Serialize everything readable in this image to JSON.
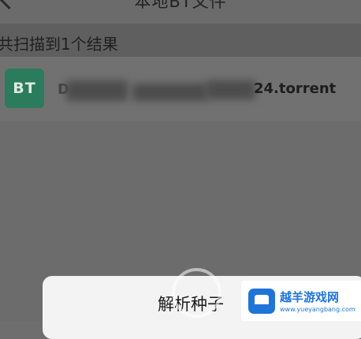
{
  "header": {
    "title": "本地BT文件"
  },
  "results": {
    "count_text": "共扫描到1个结果",
    "items": [
      {
        "icon_text": "BT",
        "name_prefix": "D",
        "name_suffix": "24.torrent"
      }
    ]
  },
  "sheet": {
    "parse_label": "解析种子"
  },
  "watermark": {
    "badge_title": "越羊游戏网",
    "badge_url": "www.yueyangbang.com"
  }
}
